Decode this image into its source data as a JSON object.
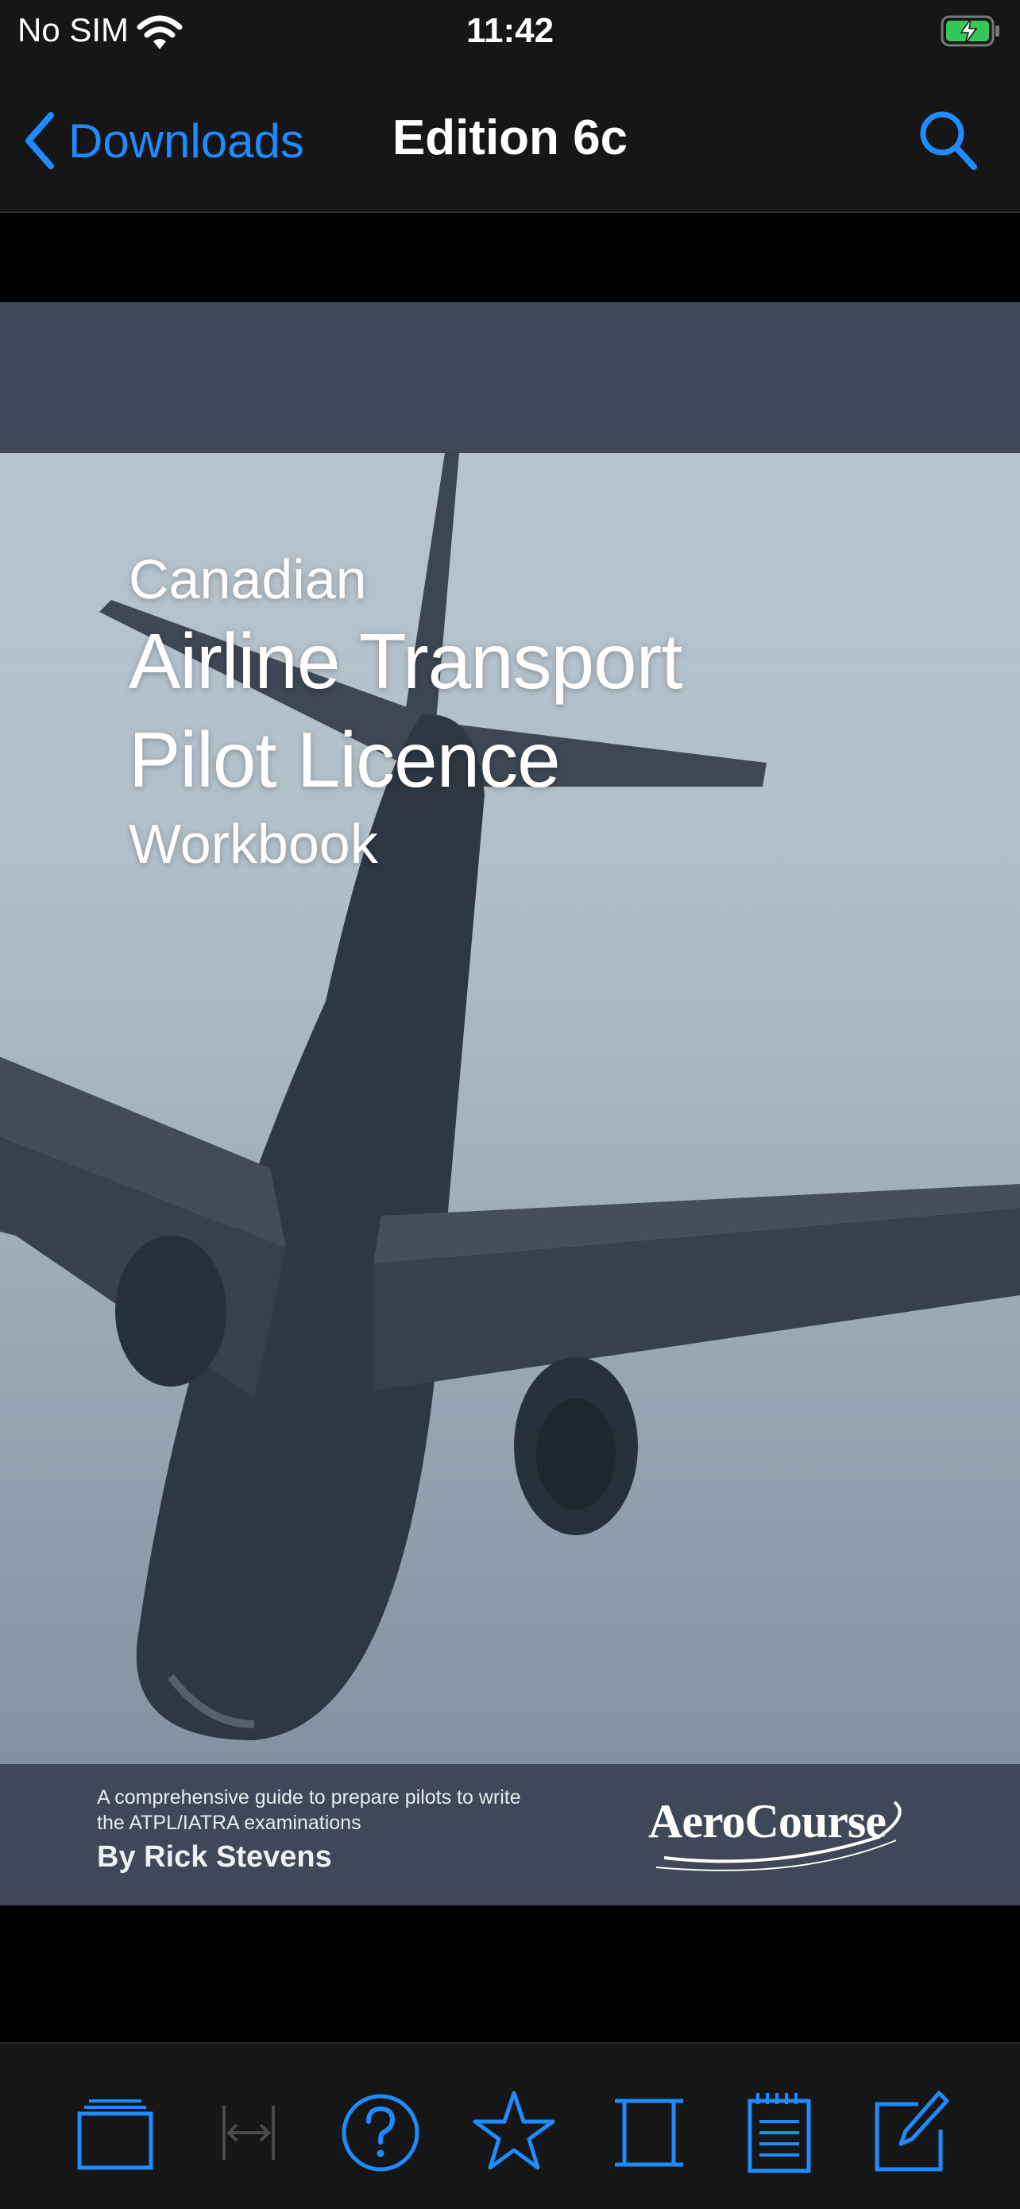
{
  "status_bar": {
    "carrier": "No SIM",
    "time": "11:42"
  },
  "nav": {
    "back_label": "Downloads",
    "title": "Edition 6c"
  },
  "cover": {
    "title_line1": "Canadian",
    "title_line2": "Airline Transport",
    "title_line3": "Pilot Licence",
    "title_line4": "Workbook",
    "tagline": "A comprehensive guide to prepare pilots to write the ATPL/IATRA examinations",
    "author": "By Rick Stevens",
    "logo_text": "AeroCourse"
  },
  "toolbar": {
    "icons": [
      "library-icon",
      "fit-width-icon",
      "help-icon",
      "bookmark-star-icon",
      "page-view-icon",
      "notes-icon",
      "edit-icon"
    ]
  },
  "colors": {
    "accent": "#1e8cff",
    "bar_background": "#161616",
    "cover_band": "#3f4859"
  }
}
